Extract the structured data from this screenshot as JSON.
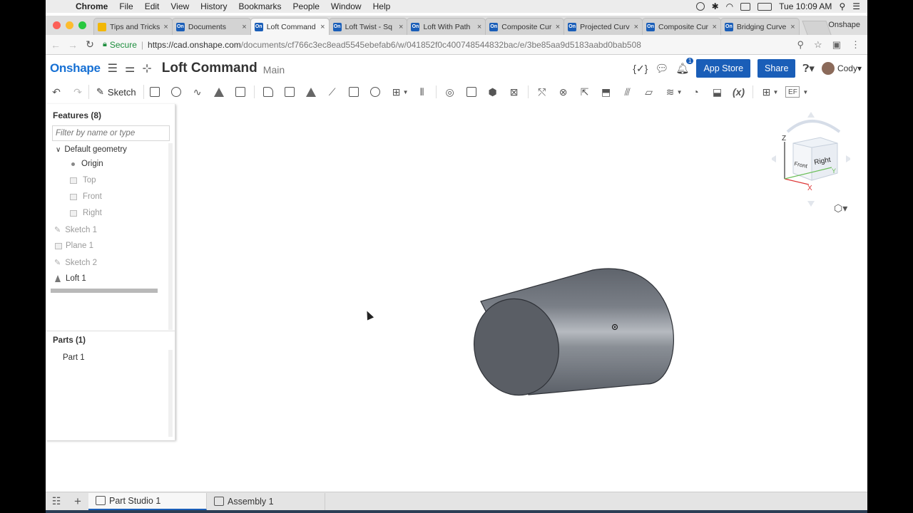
{
  "menubar": {
    "items": [
      "Chrome",
      "File",
      "Edit",
      "View",
      "History",
      "Bookmarks",
      "People",
      "Window",
      "Help"
    ],
    "clock": "Tue 10:09 AM"
  },
  "tabs": [
    {
      "label": "Tips and Tricks",
      "icon": "tips-icon",
      "active": false
    },
    {
      "label": "Documents",
      "icon": "onshape-icon",
      "active": false
    },
    {
      "label": "Loft Command",
      "icon": "onshape-icon",
      "active": true
    },
    {
      "label": "Loft Twist - Sq",
      "icon": "onshape-icon",
      "active": false
    },
    {
      "label": "Loft With Path",
      "icon": "onshape-icon",
      "active": false
    },
    {
      "label": "Composite Cur",
      "icon": "onshape-icon",
      "active": false
    },
    {
      "label": "Projected Curv",
      "icon": "onshape-icon",
      "active": false
    },
    {
      "label": "Composite Cur",
      "icon": "onshape-icon",
      "active": false
    },
    {
      "label": "Bridging Curve",
      "icon": "onshape-icon",
      "active": false
    }
  ],
  "profile_label": "Onshape",
  "address": {
    "secure_label": "Secure",
    "url_host": "https://cad.onshape.com",
    "url_path": "/documents/cf766c3ec8ead5545ebefab6/w/041852f0c400748544832bac/e/3be85aa9d5183aabd0bab508"
  },
  "header": {
    "logo": "Onshape",
    "doc_title": "Loft Command",
    "workspace": "Main",
    "notification_count": "1",
    "app_store_label": "App Store",
    "share_label": "Share",
    "user_name": "Cody"
  },
  "toolbar": {
    "sketch_label": "Sketch"
  },
  "features": {
    "title": "Features (8)",
    "filter_placeholder": "Filter by name or type",
    "group_label": "Default geometry",
    "items": [
      "Origin",
      "Top",
      "Front",
      "Right",
      "Sketch 1",
      "Plane 1",
      "Sketch 2",
      "Loft 1"
    ]
  },
  "parts": {
    "title": "Parts (1)",
    "items": [
      "Part 1"
    ]
  },
  "viewcube": {
    "front_label": "Front",
    "right_label": "Right",
    "axis_z": "Z",
    "axis_x": "X",
    "axis_y": "Y"
  },
  "bottom_tabs": [
    "Part Studio 1",
    "Assembly 1"
  ],
  "colors": {
    "brand_blue": "#1a5eb8",
    "part_gray": "#6d727a"
  }
}
